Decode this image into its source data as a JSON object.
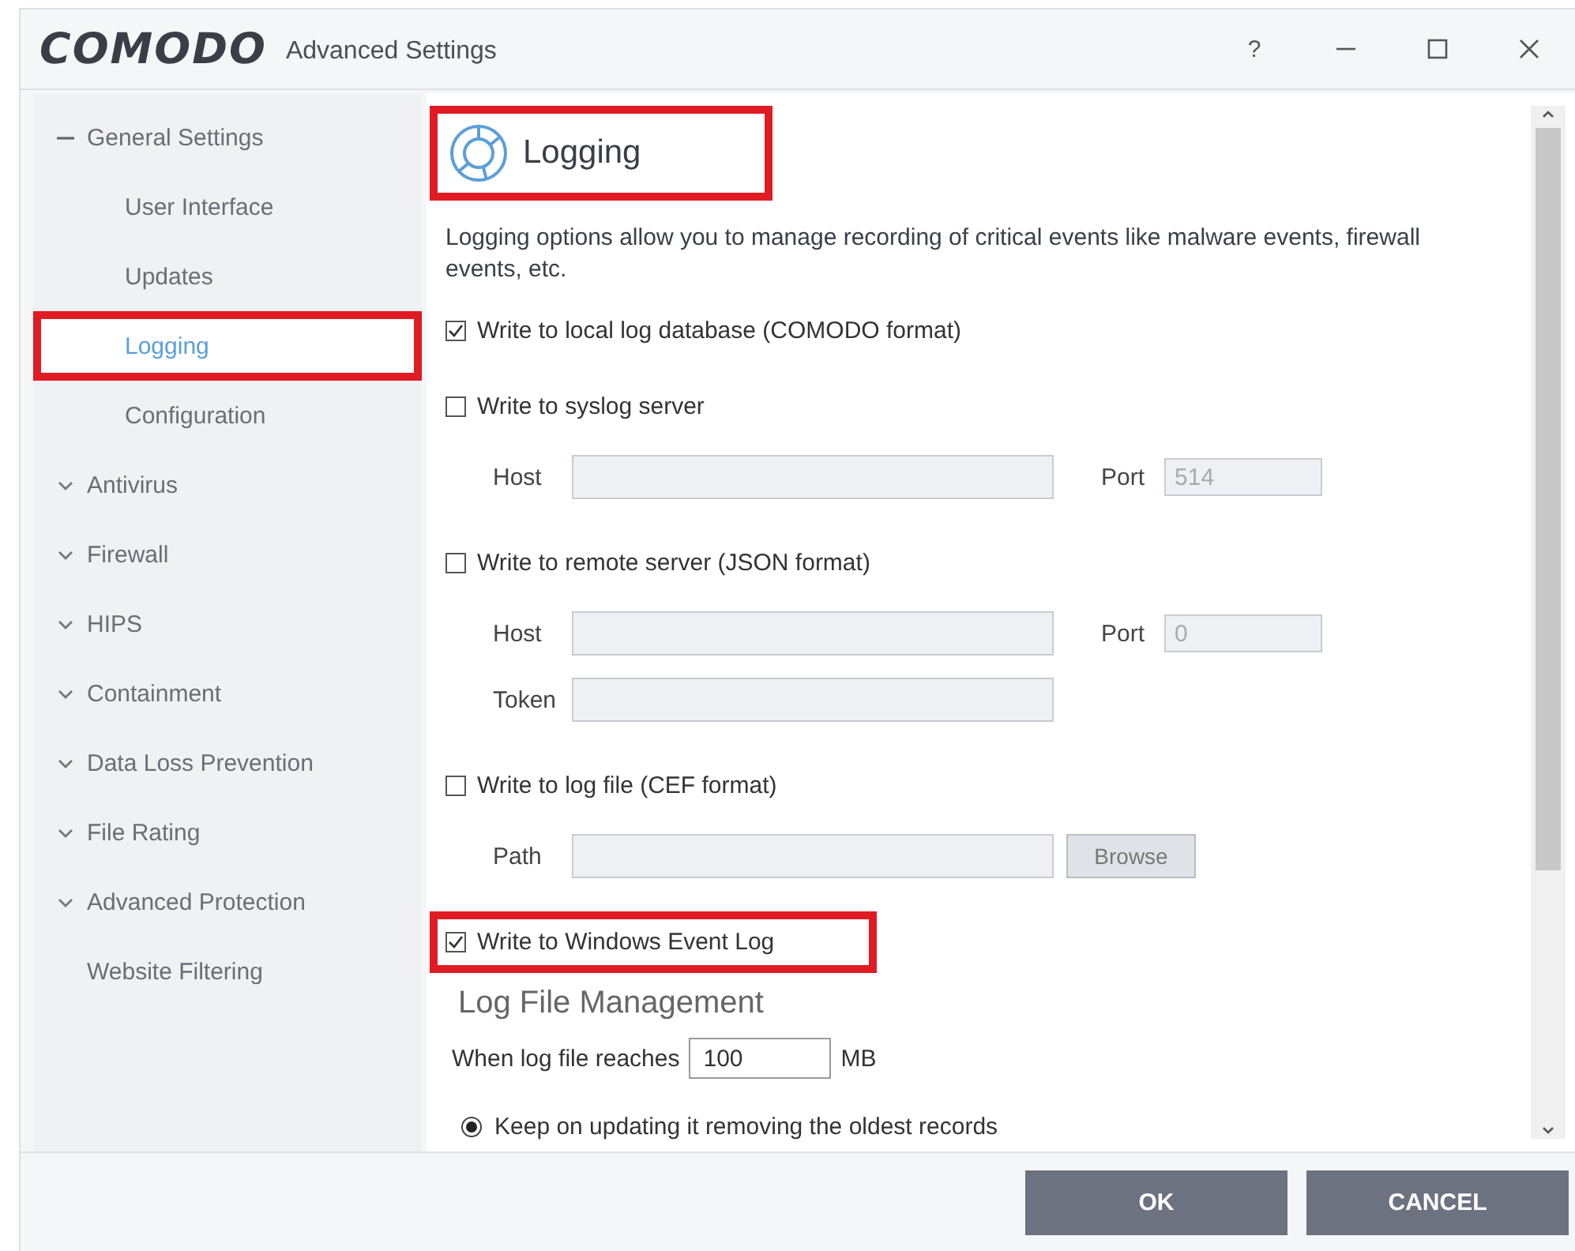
{
  "window": {
    "logo": "COMODO",
    "title": "Advanced Settings",
    "help": "?"
  },
  "sidebar": {
    "items": [
      {
        "label": "General Settings",
        "kind": "group",
        "expanded": true,
        "children": [
          {
            "label": "User Interface",
            "selected": false,
            "highlighted": false
          },
          {
            "label": "Updates",
            "selected": false,
            "highlighted": false
          },
          {
            "label": "Logging",
            "selected": true,
            "highlighted": true
          },
          {
            "label": "Configuration",
            "selected": false,
            "highlighted": false
          }
        ]
      },
      {
        "label": "Antivirus",
        "kind": "group",
        "expanded": false
      },
      {
        "label": "Firewall",
        "kind": "group",
        "expanded": false
      },
      {
        "label": "HIPS",
        "kind": "group",
        "expanded": false
      },
      {
        "label": "Containment",
        "kind": "group",
        "expanded": false
      },
      {
        "label": "Data Loss Prevention",
        "kind": "group",
        "expanded": false
      },
      {
        "label": "File Rating",
        "kind": "group",
        "expanded": false
      },
      {
        "label": "Advanced Protection",
        "kind": "group",
        "expanded": false
      },
      {
        "label": "Website Filtering",
        "kind": "link"
      }
    ]
  },
  "content": {
    "header": {
      "title": "Logging",
      "highlighted": true
    },
    "description": "Logging options allow you to manage recording of critical events like malware events, firewall events, etc.",
    "options": [
      {
        "label": "Write to local log database (COMODO format)",
        "checked": true,
        "highlighted": false
      },
      {
        "label": "Write to syslog server",
        "checked": false,
        "highlighted": false,
        "rows": [
          [
            {
              "kind": "wide",
              "label": "Host",
              "disabled": true
            },
            {
              "kind": "narrow",
              "label": "Port",
              "value": "514",
              "disabled": true
            }
          ]
        ]
      },
      {
        "label": "Write to remote server (JSON format)",
        "checked": false,
        "highlighted": false,
        "rows": [
          [
            {
              "kind": "wide",
              "label": "Host",
              "disabled": true
            },
            {
              "kind": "narrow",
              "label": "Port",
              "value": "0",
              "disabled": true
            }
          ],
          [
            {
              "kind": "wide",
              "label": "Token",
              "disabled": true
            }
          ]
        ]
      },
      {
        "label": "Write to log file (CEF format)",
        "checked": false,
        "highlighted": false,
        "rows": [
          [
            {
              "kind": "wide",
              "label": "Path",
              "disabled": true
            },
            {
              "kind": "button",
              "label": "Browse",
              "disabled": true
            }
          ]
        ]
      },
      {
        "label": "Write to Windows Event Log",
        "checked": true,
        "highlighted": true
      }
    ],
    "management": {
      "title": "Log File Management",
      "size_label": "When log file reaches",
      "size_value": "100",
      "size_unit": "MB",
      "radios": [
        {
          "label": "Keep on updating it removing the oldest records",
          "selected": true
        }
      ]
    }
  },
  "footer": {
    "buttons": [
      "OK",
      "CANCEL"
    ]
  }
}
